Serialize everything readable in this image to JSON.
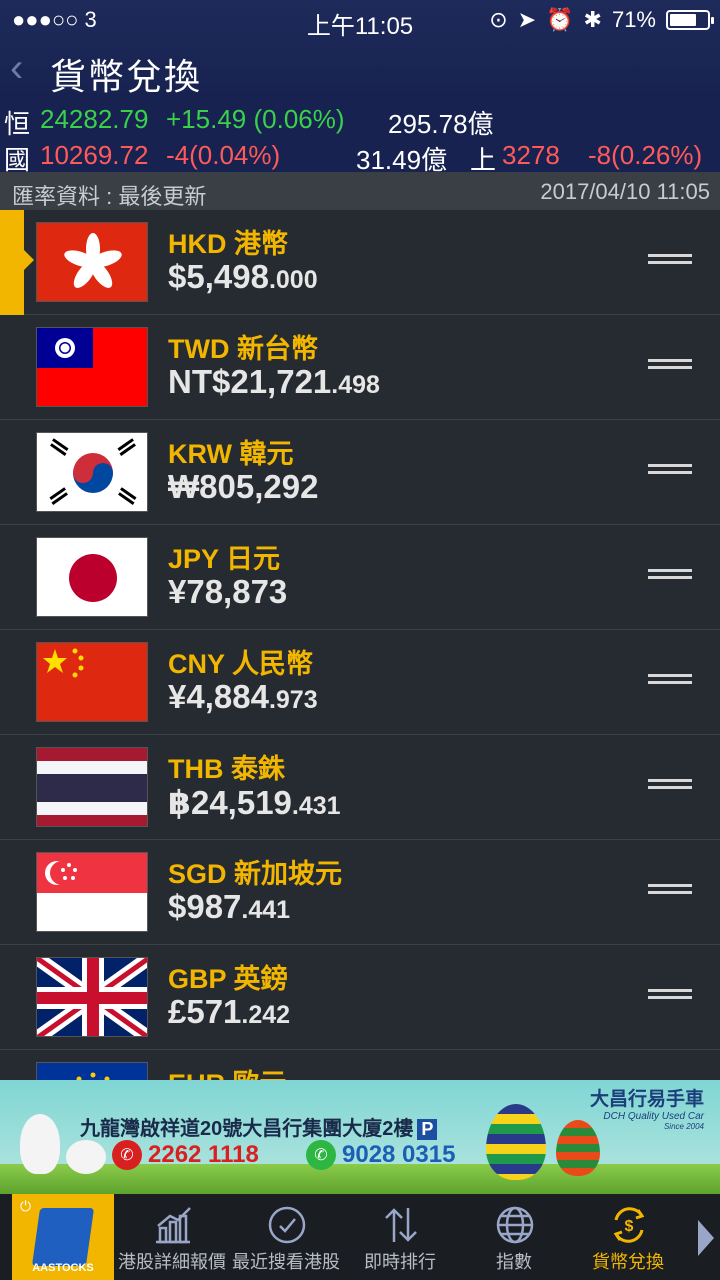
{
  "status_bar": {
    "carrier": "●●●○○ 3",
    "time": "上午11:05",
    "battery": "71%",
    "battery_level": 0.71
  },
  "header": {
    "back_icon": "chevron-left-icon",
    "title": "貨幣兌換"
  },
  "ticker": {
    "hsi": {
      "label": "恒",
      "value": "24282.79",
      "change": "+15.49 (0.06%)",
      "turnover": "295.78億"
    },
    "hscei": {
      "label": "國",
      "value": "10269.72",
      "change": "-4(0.04%)",
      "turnover": "31.49億",
      "sh_label": "上",
      "sh_value": "3278",
      "sh_change": "-8(0.26%)"
    }
  },
  "update": {
    "label": "匯率資料 : 最後更新",
    "timestamp": "2017/04/10 11:05"
  },
  "currencies": [
    {
      "code": "HKD 港幣",
      "main": "$5,498",
      "dec": ".000",
      "selected": true
    },
    {
      "code": "TWD 新台幣",
      "main": "NT$21,721",
      "dec": ".498"
    },
    {
      "code": "KRW 韓元",
      "main": "₩805,292",
      "dec": ""
    },
    {
      "code": "JPY 日元",
      "main": "¥78,873",
      "dec": ""
    },
    {
      "code": "CNY 人民幣",
      "main": "¥4,884",
      "dec": ".973"
    },
    {
      "code": "THB 泰銖",
      "main": "฿24,519",
      "dec": ".431"
    },
    {
      "code": "SGD 新加坡元",
      "main": "$987",
      "dec": ".441"
    },
    {
      "code": "GBP 英鎊",
      "main": "£571",
      "dec": ".242"
    },
    {
      "code": "EUR 歐元",
      "main": "",
      "dec": ""
    }
  ],
  "ad": {
    "address": "九龍灣啟祥道20號大昌行集團大廈2樓",
    "parking": "P",
    "phone": "2262 1118",
    "whatsapp": "9028 0315",
    "brand_cn": "大昌行易手車",
    "brand_en": "DCH Quality Used Car",
    "brand_since": "Since 2004"
  },
  "tabbar": {
    "logo_text": "AASTOCKS",
    "tabs": [
      {
        "label": "港股詳細報價",
        "icon": "chart-icon"
      },
      {
        "label": "最近搜看港股",
        "icon": "clock-icon"
      },
      {
        "label": "即時排行",
        "icon": "updown-arrows-icon"
      },
      {
        "label": "指數",
        "icon": "globe-icon"
      },
      {
        "label": "貨幣兌換",
        "icon": "currency-exchange-icon",
        "active": true
      }
    ]
  }
}
